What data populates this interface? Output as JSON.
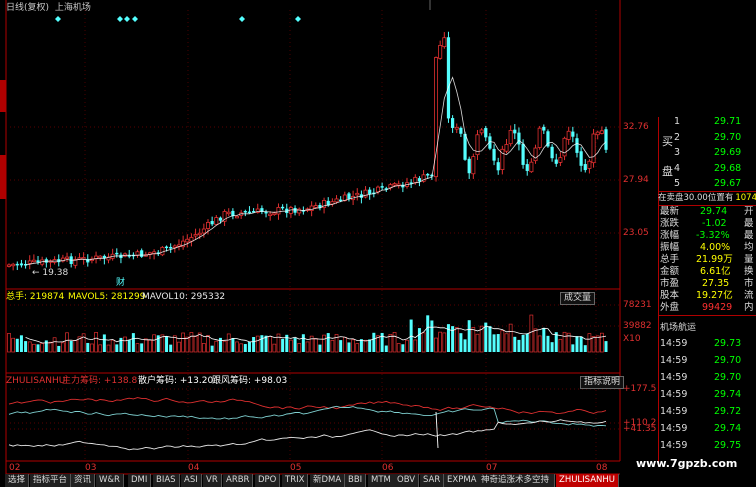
{
  "header": {
    "title": "日线(复权)",
    "stock_name": "上海机场"
  },
  "price_axis": [
    "32.76",
    "27.94",
    "23.05"
  ],
  "price_annotation_low": "19.38",
  "finance_marker": "财",
  "volume_panel": {
    "total_label": "总手: 219874",
    "ma5_label": "MAVOL5: 281299",
    "ma10_label": "MAVOL10: 295332",
    "button": "成交量",
    "axis": [
      "78231",
      "39882"
    ],
    "axis_unit": "X10"
  },
  "indicator_panel": {
    "name": "ZHULISANHU",
    "main_label": "主力筹码: +138.8",
    "retail_label": "散户筹码: +13.20",
    "hot_label": "跟风筹码: +98.03",
    "button": "指标说明",
    "axis": [
      "+177.5",
      "+110.2",
      "+41.35"
    ]
  },
  "x_axis_labels": [
    "02",
    "03",
    "04",
    "05",
    "06",
    "07",
    "08"
  ],
  "bottom_tabs": [
    "选择",
    "指标平台",
    "资讯",
    "W&R",
    "DMI",
    "BIAS",
    "ASI",
    "VR",
    "ARBR",
    "DPO",
    "TRIX",
    "新DMA",
    "BBI",
    "MTM",
    "OBV",
    "SAR",
    "EXPMA",
    "神奇追涨术多空持",
    "ZHULISANHU"
  ],
  "quote_panel": {
    "buy_label": "买",
    "buy_label2": "盘",
    "buy_rows": [
      {
        "level": "1",
        "price": "29.71"
      },
      {
        "level": "2",
        "price": "29.70"
      },
      {
        "level": "3",
        "price": "29.69"
      },
      {
        "level": "4",
        "price": "29.68"
      },
      {
        "level": "5",
        "price": "29.67"
      }
    ],
    "status_line": "在卖盘30.00位置有",
    "status_value": "10748",
    "stats": [
      {
        "label": "最新",
        "value": "29.74",
        "tail": "开"
      },
      {
        "label": "涨跌",
        "value": "-1.02",
        "tail": "最"
      },
      {
        "label": "涨幅",
        "value": "-3.32%",
        "tail": "最"
      },
      {
        "label": "振幅",
        "value": "4.00%",
        "tail": "均"
      },
      {
        "label": "总手",
        "value": "21.99万",
        "tail": "量"
      },
      {
        "label": "金额",
        "value": "6.61亿",
        "tail": "换"
      },
      {
        "label": "市盈",
        "value": "27.35",
        "tail": "市"
      },
      {
        "label": "股本",
        "value": "19.27亿",
        "tail": "流"
      },
      {
        "label": "外盘",
        "value": "99429",
        "tail": "内"
      }
    ],
    "ticks_title": "机场航运",
    "ticks": [
      {
        "time": "14:59",
        "price": "29.73"
      },
      {
        "time": "14:59",
        "price": "29.70"
      },
      {
        "time": "14:59",
        "price": "29.70"
      },
      {
        "time": "14:59",
        "price": "29.74"
      },
      {
        "time": "14:59",
        "price": "29.72"
      },
      {
        "time": "14:59",
        "price": "29.74"
      },
      {
        "time": "14:59",
        "price": "29.75"
      }
    ]
  },
  "watermark": "www.7gpzb.com",
  "colors": {
    "up": "#e03030",
    "down": "#54ffff",
    "axis_red": "#b00000",
    "label_yellow": "#ffff00",
    "price_green": "#00ff00"
  },
  "chart_data": {
    "type": "candlestick",
    "y_axis_ticks": [
      32.76,
      27.94,
      23.05
    ],
    "annotated_low": 19.38,
    "x_months": [
      "02",
      "03",
      "04",
      "05",
      "06",
      "07",
      "08"
    ],
    "last_close": 29.74,
    "indicator_series": [
      {
        "name": "主力筹码",
        "last": 138.8
      },
      {
        "name": "散户筹码",
        "last": 13.2
      },
      {
        "name": "跟风筹码",
        "last": 98.03
      }
    ],
    "indicator_axis_ticks": [
      177.5,
      110.2,
      41.35
    ],
    "volume_axis_ticks": [
      78231,
      39882
    ]
  }
}
